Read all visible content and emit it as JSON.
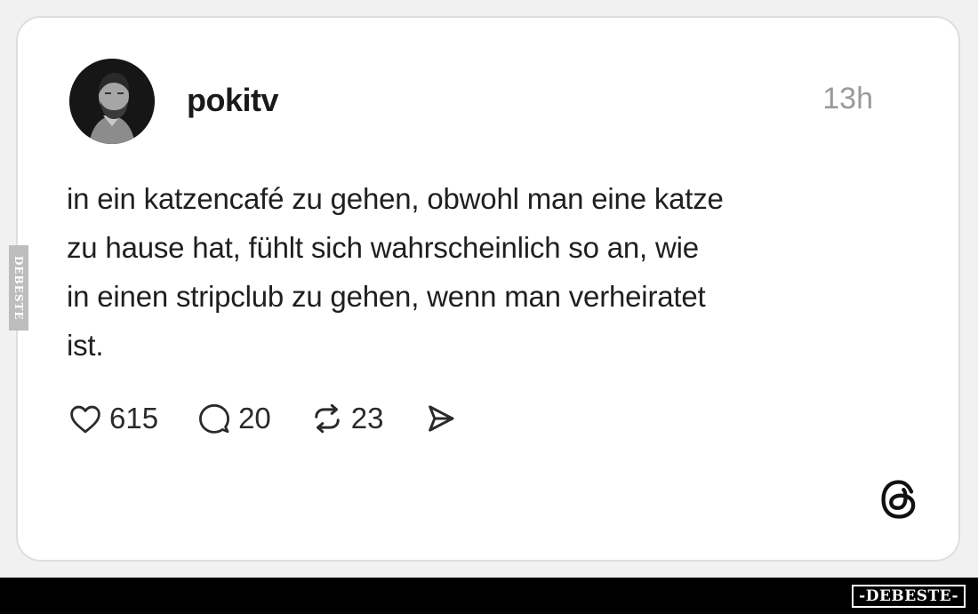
{
  "post": {
    "username": "pokitv",
    "time": "13h",
    "text_lines": [
      "in ein katzencafé zu gehen, obwohl man eine katze",
      "zu hause hat, fühlt sich wahrscheinlich so an, wie",
      "in einen stripclub zu gehen, wenn man verheiratet",
      "ist."
    ]
  },
  "actions": {
    "likes": "615",
    "replies": "20",
    "reposts": "23"
  },
  "icons": {
    "like": "heart-icon",
    "reply": "speech-bubble-icon",
    "repost": "repost-icon",
    "share": "send-icon",
    "brand": "threads-logo-icon"
  },
  "watermark": {
    "side": "DEBESTE",
    "bottom": "-DEBESTE-"
  },
  "colors": {
    "card_background": "#ffffff",
    "page_background": "#f1f1f1",
    "text": "#1f1f1f",
    "timestamp": "#9a9a9a",
    "bottom_bar": "#000000"
  }
}
